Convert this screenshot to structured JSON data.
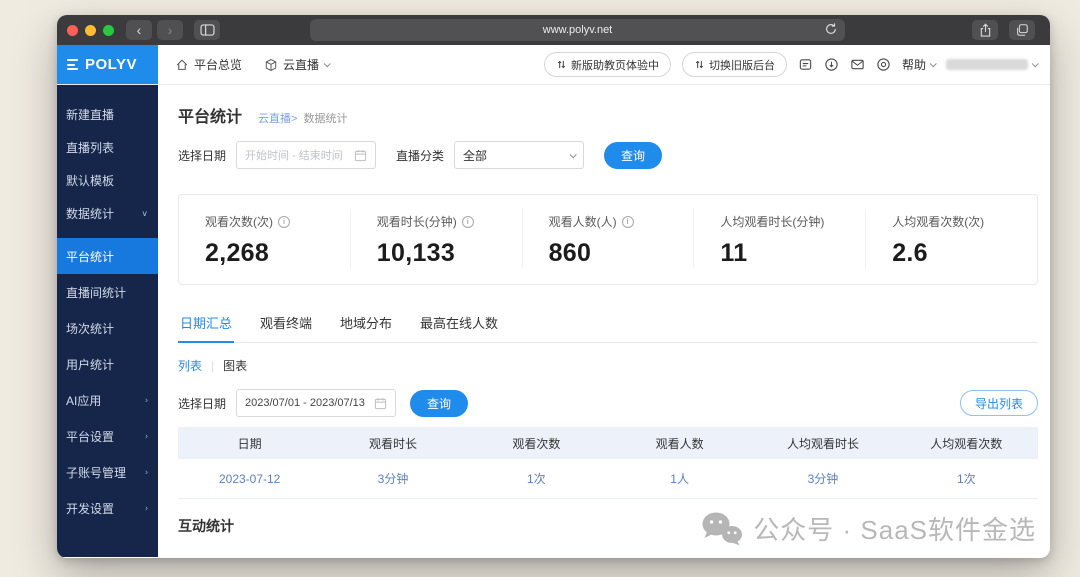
{
  "browser": {
    "url": "www.polyv.net"
  },
  "header": {
    "nav": [
      {
        "label": "平台总览"
      },
      {
        "label": "云直播"
      }
    ],
    "pills": [
      {
        "label": "新版助教页体验中"
      },
      {
        "label": "切换旧版后台"
      }
    ],
    "help_label": "帮助"
  },
  "sidebar": {
    "logo": "POLYV",
    "items": [
      {
        "label": "新建直播",
        "chevron": ""
      },
      {
        "label": "直播列表",
        "chevron": ""
      },
      {
        "label": "默认模板",
        "chevron": ""
      },
      {
        "label": "数据统计",
        "chevron": "∨"
      },
      {
        "label": "平台统计",
        "chevron": ""
      },
      {
        "label": "直播间统计",
        "chevron": ""
      },
      {
        "label": "场次统计",
        "chevron": ""
      },
      {
        "label": "用户统计",
        "chevron": ""
      },
      {
        "label": "AI应用",
        "chevron": "›"
      },
      {
        "label": "平台设置",
        "chevron": "›"
      },
      {
        "label": "子账号管理",
        "chevron": "›"
      },
      {
        "label": "开发设置",
        "chevron": "›"
      }
    ]
  },
  "page": {
    "title": "平台统计",
    "breadcrumb_parent": "云直播>",
    "breadcrumb_current": "数据统计"
  },
  "filters": {
    "date_label": "选择日期",
    "date_placeholder": "开始时间 - 结束时间",
    "category_label": "直播分类",
    "category_value": "全部",
    "search_label": "查询"
  },
  "stats": [
    {
      "label": "观看次数(次)",
      "value": "2,268"
    },
    {
      "label": "观看时长(分钟)",
      "value": "10,133"
    },
    {
      "label": "观看人数(人)",
      "value": "860"
    },
    {
      "label": "人均观看时长(分钟)",
      "value": "11"
    },
    {
      "label": "人均观看次数(次)",
      "value": "2.6"
    }
  ],
  "tabs": [
    {
      "label": "日期汇总"
    },
    {
      "label": "观看终端"
    },
    {
      "label": "地域分布"
    },
    {
      "label": "最高在线人数"
    }
  ],
  "view_toggle": {
    "list": "列表",
    "chart": "图表"
  },
  "filters2": {
    "date_label": "选择日期",
    "date_value": "2023/07/01 - 2023/07/13",
    "search_label": "查询",
    "export_label": "导出列表"
  },
  "table": {
    "headers": [
      "日期",
      "观看时长",
      "观看次数",
      "观看人数",
      "人均观看时长",
      "人均观看次数"
    ],
    "rows": [
      [
        "2023-07-12",
        "3分钟",
        "1次",
        "1人",
        "3分钟",
        "1次"
      ]
    ]
  },
  "section_interaction": "互动统计",
  "watermark": "公众号 · SaaS软件金选"
}
